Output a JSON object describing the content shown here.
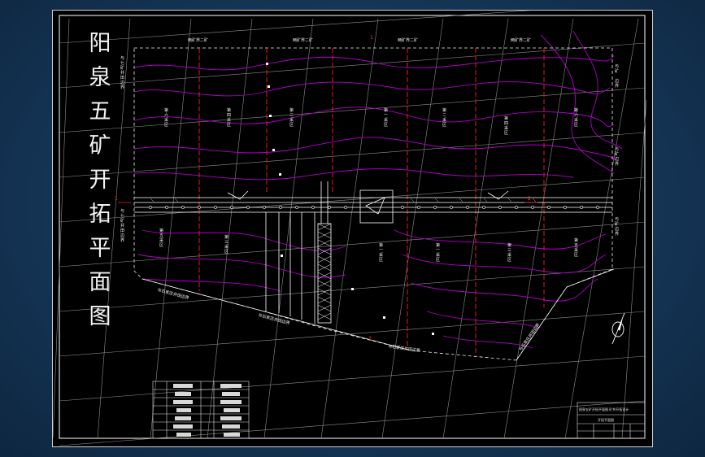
{
  "title": {
    "chars": [
      "阳",
      "泉",
      "五",
      "矿",
      "开",
      "拓",
      "平",
      "面",
      "图"
    ]
  },
  "labels": {
    "top_boundary": [
      "两矿界二矿",
      "两矿界二矿",
      "两矿界二矿",
      "两矿界二矿"
    ],
    "left_upper": "与七矿井田边界",
    "left_lower": "与七矿井田边界",
    "right_upper_a": "与矿",
    "right_upper_b": "边界",
    "right_upper_c": "与矿边界",
    "right_lower": "与矿边界",
    "bottom_left_a": "与石家庄井田边界",
    "bottom_left_b": "与石家庄井田边界",
    "bottom_center": "与石家庄井田边界",
    "bottom_right": "与石家庄井田边界"
  },
  "panels_upper": [
    "第六采区",
    "第四采区",
    "第二采区",
    "第一采区",
    "第二采区",
    "第四采区",
    "第六采区"
  ],
  "panels_lower": [
    "第五采区",
    "第三采区",
    "第一采区",
    "第一采区",
    "第三采区",
    "第五采区"
  ],
  "section_marks": {
    "top": "1",
    "left": "1",
    "bottom": "2",
    "right": "2"
  },
  "title_block": {
    "heading": "阳泉五矿开拓平面图 矿井开拓设计",
    "row2": "开拓平面图"
  },
  "colors": {
    "sheet_bg": "#000000",
    "contour": "#b000c8",
    "boundary_red": "#e51c1c",
    "grid": "#9a9a9a",
    "frame": "#ffffff"
  }
}
